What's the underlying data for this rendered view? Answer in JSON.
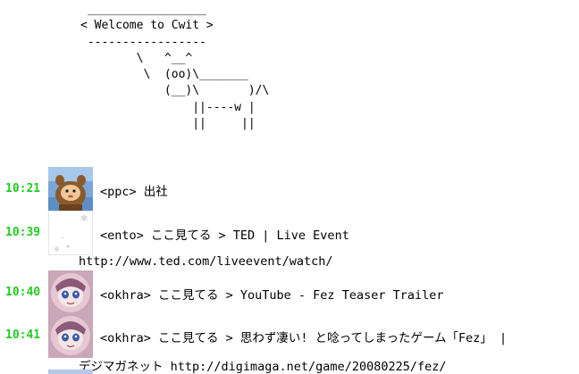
{
  "banner": {
    "ascii": " _________________\n< Welcome to Cwit >\n -----------------\n        \\   ^__^\n         \\  (oo)\\_______\n            (__)\\       )/\\\n                ||----w |\n                ||     ||"
  },
  "messages": [
    {
      "time": "10:21",
      "avatar": "bear-costume-avatar",
      "text": "<ppc> 出社",
      "continuation": ""
    },
    {
      "time": "10:39",
      "avatar": "blank-snowflake-avatar",
      "text": "<ento> ここ見てる > TED | Live Event",
      "continuation": "http://www.ted.com/liveevent/watch/"
    },
    {
      "time": "10:40",
      "avatar": "anime-face-avatar",
      "text": "<okhra> ここ見てる > YouTube - Fez Teaser Trailer",
      "continuation": ""
    },
    {
      "time": "10:41",
      "avatar": "anime-face-avatar",
      "text": "<okhra> ここ見てる > 思わず凄い! と唸ってしまったゲーム「Fez」 |",
      "continuation": "デジマガネット http://digimaga.net/game/20080225/fez/"
    }
  ],
  "colors": {
    "timestamp": "#22cc22",
    "text": "#000000",
    "background": "#ffffff"
  }
}
